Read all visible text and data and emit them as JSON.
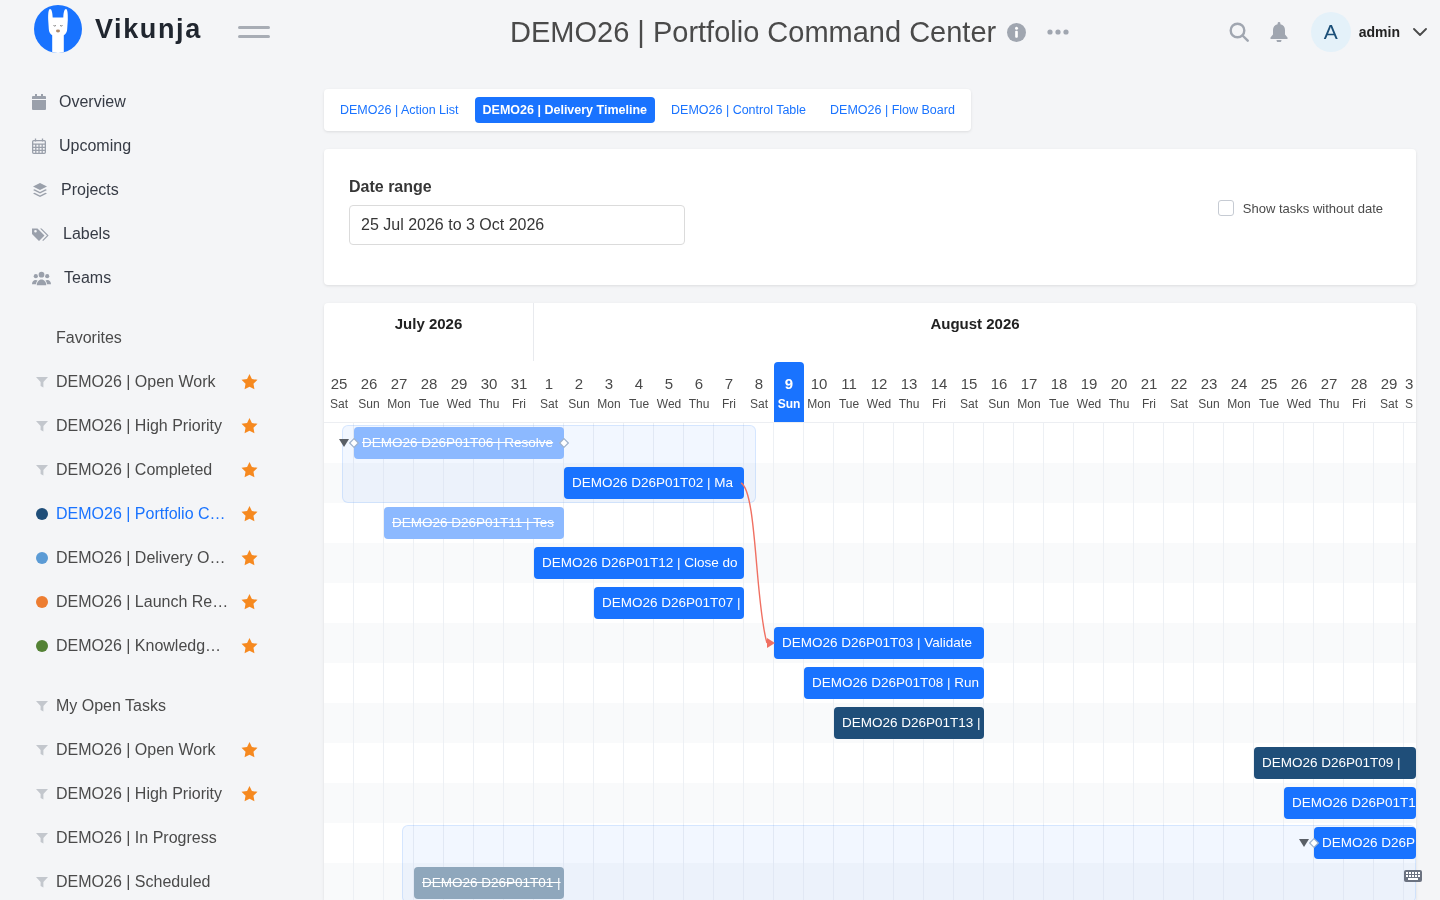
{
  "header": {
    "logo": "Vikunja",
    "title": "DEMO26 | Portfolio Command Center",
    "user": {
      "initial": "A",
      "name": "admin"
    }
  },
  "sidebar": {
    "menu": [
      {
        "label": "Overview"
      },
      {
        "label": "Upcoming"
      },
      {
        "label": "Projects"
      },
      {
        "label": "Labels"
      },
      {
        "label": "Teams"
      }
    ],
    "project_groups": [
      {
        "title": "Favorites",
        "items": [
          {
            "label": "DEMO26 | Open Work",
            "kind": "filter",
            "favorite": true,
            "selected": false
          },
          {
            "label": "DEMO26 | High Priority",
            "kind": "filter",
            "favorite": true,
            "selected": false
          },
          {
            "label": "DEMO26 | Completed",
            "kind": "filter",
            "favorite": true,
            "selected": false
          },
          {
            "label": "DEMO26 | Portfolio C…",
            "kind": "project",
            "color": "#1f4e79",
            "favorite": true,
            "selected": true
          },
          {
            "label": "DEMO26 | Delivery O…",
            "kind": "project",
            "color": "#5b9bd5",
            "favorite": true,
            "selected": false
          },
          {
            "label": "DEMO26 | Launch Re…",
            "kind": "project",
            "color": "#ed7d31",
            "favorite": true,
            "selected": false
          },
          {
            "label": "DEMO26 | Knowledg…",
            "kind": "project",
            "color": "#548235",
            "favorite": true,
            "selected": false
          }
        ]
      },
      {
        "items": [
          {
            "label": "My Open Tasks",
            "kind": "filter",
            "favorite": false,
            "selected": false
          },
          {
            "label": "DEMO26 | Open Work",
            "kind": "filter",
            "favorite": true,
            "selected": false
          },
          {
            "label": "DEMO26 | High Priority",
            "kind": "filter",
            "favorite": true,
            "selected": false
          },
          {
            "label": "DEMO26 | In Progress",
            "kind": "filter",
            "favorite": false,
            "selected": false
          },
          {
            "label": "DEMO26 | Scheduled",
            "kind": "filter",
            "favorite": false,
            "selected": false
          }
        ]
      }
    ]
  },
  "views": [
    {
      "label": "DEMO26 | Action List",
      "selected": false
    },
    {
      "label": "DEMO26 | Delivery Timeline",
      "selected": true
    },
    {
      "label": "DEMO26 | Control Table",
      "selected": false
    },
    {
      "label": "DEMO26 | Flow Board",
      "selected": false
    }
  ],
  "filters": {
    "label": "Date range",
    "date_range": {
      "value": "25 Jul 2026 to 3 Oct 2026"
    },
    "show_without_date": {
      "label": "Show tasks without date",
      "checked": false
    }
  },
  "gantt": {
    "months": [
      {
        "label": "July 2026",
        "days": [
          {
            "day": "25",
            "weekday": "Sat",
            "today": false
          },
          {
            "day": "26",
            "weekday": "Sun",
            "today": false
          },
          {
            "day": "27",
            "weekday": "Mon",
            "today": false
          },
          {
            "day": "28",
            "weekday": "Tue",
            "today": false
          },
          {
            "day": "29",
            "weekday": "Wed",
            "today": false
          },
          {
            "day": "30",
            "weekday": "Thu",
            "today": false
          },
          {
            "day": "31",
            "weekday": "Fri",
            "today": false
          }
        ]
      },
      {
        "label": "August 2026",
        "days": [
          {
            "day": "1",
            "weekday": "Sat",
            "today": false
          },
          {
            "day": "2",
            "weekday": "Sun",
            "today": false
          },
          {
            "day": "3",
            "weekday": "Mon",
            "today": false
          },
          {
            "day": "4",
            "weekday": "Tue",
            "today": false
          },
          {
            "day": "5",
            "weekday": "Wed",
            "today": false
          },
          {
            "day": "6",
            "weekday": "Thu",
            "today": false
          },
          {
            "day": "7",
            "weekday": "Fri",
            "today": false
          },
          {
            "day": "8",
            "weekday": "Sat",
            "today": false
          },
          {
            "day": "9",
            "weekday": "Sun",
            "today": true
          },
          {
            "day": "10",
            "weekday": "Mon",
            "today": false
          },
          {
            "day": "11",
            "weekday": "Tue",
            "today": false
          },
          {
            "day": "12",
            "weekday": "Wed",
            "today": false
          },
          {
            "day": "13",
            "weekday": "Thu",
            "today": false
          },
          {
            "day": "14",
            "weekday": "Fri",
            "today": false
          },
          {
            "day": "15",
            "weekday": "Sat",
            "today": false
          },
          {
            "day": "16",
            "weekday": "Sun",
            "today": false
          },
          {
            "day": "17",
            "weekday": "Mon",
            "today": false
          },
          {
            "day": "18",
            "weekday": "Tue",
            "today": false
          },
          {
            "day": "19",
            "weekday": "Wed",
            "today": false
          },
          {
            "day": "20",
            "weekday": "Thu",
            "today": false
          },
          {
            "day": "21",
            "weekday": "Fri",
            "today": false
          },
          {
            "day": "22",
            "weekday": "Sat",
            "today": false
          },
          {
            "day": "23",
            "weekday": "Sun",
            "today": false
          },
          {
            "day": "24",
            "weekday": "Mon",
            "today": false
          },
          {
            "day": "25",
            "weekday": "Tue",
            "today": false
          },
          {
            "day": "26",
            "weekday": "Wed",
            "today": false
          },
          {
            "day": "27",
            "weekday": "Thu",
            "today": false
          },
          {
            "day": "28",
            "weekday": "Fri",
            "today": false
          },
          {
            "day": "29",
            "weekday": "Sat",
            "today": false
          },
          {
            "day": "3",
            "weekday": "S",
            "today": false
          }
        ]
      }
    ],
    "tasks": [
      {
        "title": "DEMO26 D26P01T06 | Resolve",
        "color": "#8cb9ff",
        "done": true,
        "dependency_out": false,
        "dependency_in": false,
        "expanded": true,
        "children": [
          {
            "title": "DEMO26 D26P01T02 | Ma",
            "color": "#1973ff",
            "done": false,
            "dependency_out": true,
            "dependency_in": false
          }
        ]
      },
      {
        "title": "DEMO26 D26P01T11 | Tes",
        "color": "#8cb9ff",
        "done": true,
        "dependency_out": false,
        "dependency_in": false
      },
      {
        "title": "DEMO26 D26P01T12 | Close do",
        "color": "#1973ff",
        "done": false,
        "dependency_out": false,
        "dependency_in": false
      },
      {
        "title": "DEMO26 D26P01T07 |",
        "color": "#1973ff",
        "done": false,
        "dependency_out": false,
        "dependency_in": false
      },
      {
        "title": "DEMO26 D26P01T03 | Validate",
        "color": "#1973ff",
        "done": false,
        "dependency_out": false,
        "dependency_in": true
      },
      {
        "title": "DEMO26 D26P01T08 | Run",
        "color": "#1973ff",
        "done": false,
        "dependency_out": false,
        "dependency_in": false
      },
      {
        "title": "DEMO26 D26P01T13 |",
        "color": "#1f4e79",
        "done": false,
        "dependency_out": false,
        "dependency_in": false
      },
      {
        "title": "DEMO26 D26P01T09 |",
        "color": "#1f4e79",
        "done": false,
        "dependency_out": false,
        "dependency_in": false
      },
      {
        "title": "DEMO26 D26P01T1",
        "color": "#1973ff",
        "done": false,
        "dependency_out": false,
        "dependency_in": false
      },
      {
        "title": "DEMO26 D26P",
        "color": "#1973ff",
        "done": false,
        "dependency_out": false,
        "dependency_in": false,
        "expanded": true,
        "children": [
          {
            "title": "DEMO26 D26P01T01 |",
            "color": "#8fa7bc",
            "done": true,
            "dependency_out": false,
            "dependency_in": false
          }
        ]
      }
    ]
  }
}
